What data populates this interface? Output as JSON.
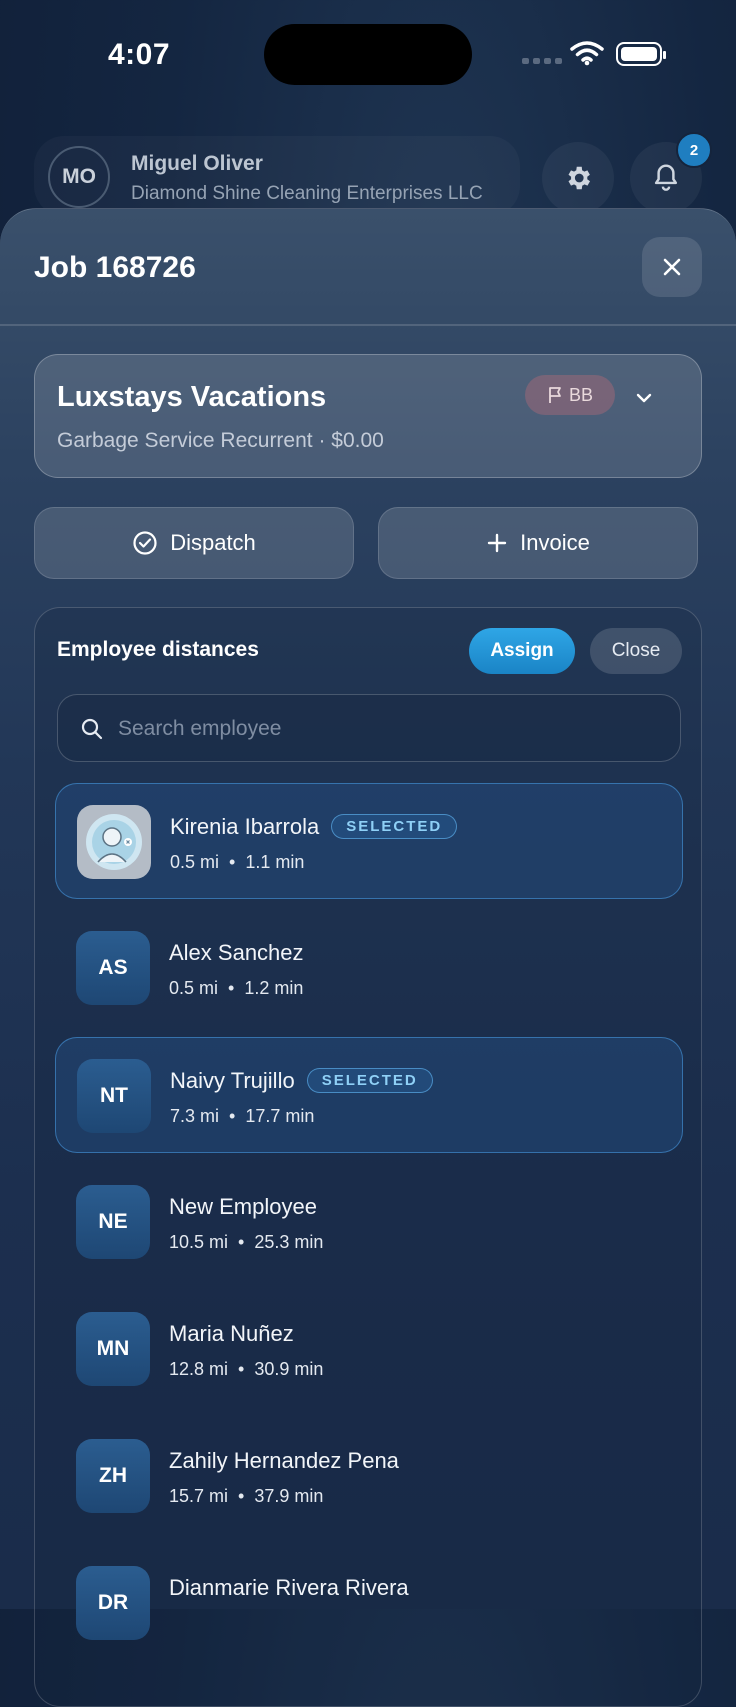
{
  "status_bar": {
    "time": "4:07"
  },
  "header": {
    "user_initials": "MO",
    "user_name": "Miguel Oliver",
    "company": "Diamond Shine Cleaning Enterprises LLC",
    "notification_count": "2"
  },
  "job": {
    "title": "Job 168726",
    "client_name": "Luxstays Vacations",
    "service_line": "Garbage Service Recurrent · $0.00",
    "tag": "BB"
  },
  "actions": {
    "dispatch_label": "Dispatch",
    "invoice_label": "Invoice"
  },
  "distances": {
    "title": "Employee distances",
    "assign_label": "Assign",
    "close_label": "Close",
    "search_placeholder": "Search employee",
    "selected_label": "SELECTED",
    "employees": [
      {
        "initials": "",
        "name": "Kirenia Ibarrola",
        "distance": "0.5 mi",
        "time": "1.1 min",
        "selected": true,
        "photo": true
      },
      {
        "initials": "AS",
        "name": "Alex Sanchez",
        "distance": "0.5 mi",
        "time": "1.2 min",
        "selected": false
      },
      {
        "initials": "NT",
        "name": "Naivy Trujillo",
        "distance": "7.3 mi",
        "time": "17.7 min",
        "selected": true
      },
      {
        "initials": "NE",
        "name": "New Employee",
        "distance": "10.5 mi",
        "time": "25.3 min",
        "selected": false
      },
      {
        "initials": "MN",
        "name": "Maria Nuñez",
        "distance": "12.8 mi",
        "time": "30.9 min",
        "selected": false
      },
      {
        "initials": "ZH",
        "name": "Zahily Hernandez Pena",
        "distance": "15.7 mi",
        "time": "37.9 min",
        "selected": false
      },
      {
        "initials": "DR",
        "name": "Dianmarie Rivera Rivera",
        "distance": "",
        "time": "",
        "selected": false
      }
    ]
  },
  "colors": {
    "accent": "#1f8fd6",
    "selected_border": "#4696dc",
    "background": "#142641"
  }
}
